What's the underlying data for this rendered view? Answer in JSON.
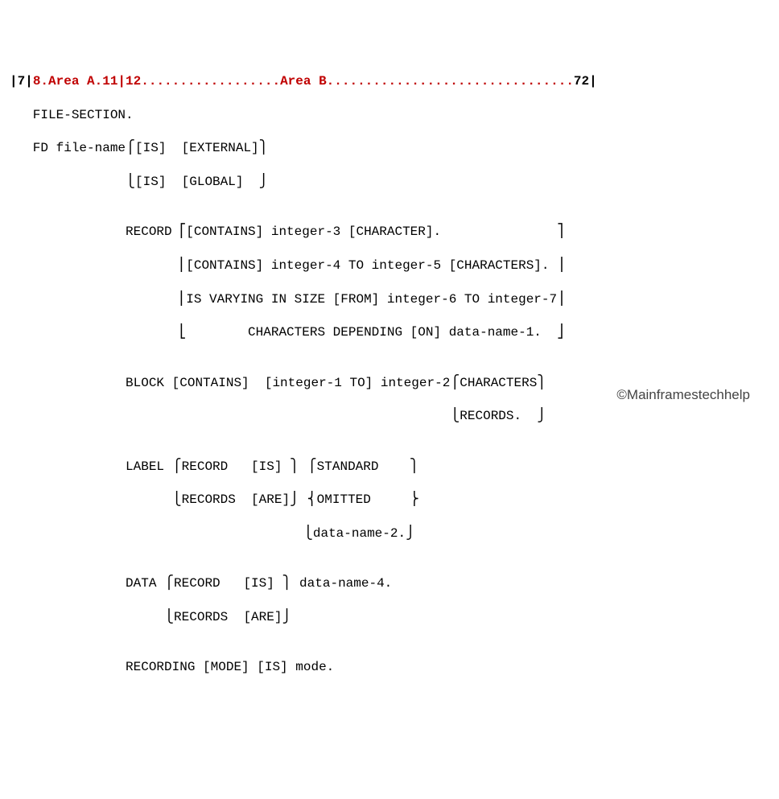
{
  "ruler": {
    "col7": "|7|",
    "col8": "8.",
    "areaA": "Area A",
    "col11": ".11|",
    "col12": "12",
    "dotsL": "..................",
    "areaB": "Area B",
    "dotsR": "................................",
    "col72": "72|"
  },
  "lines": {
    "fileSection": "   FILE-SECTION.",
    "fd1": "   FD file-name⎧[IS]  [EXTERNAL]⎫",
    "fd2": "               ⎩[IS]  [GLOBAL]  ⎭",
    "blank1": "",
    "rec1": "               RECORD ⎡[CONTAINS] integer-3 [CHARACTER].               ⎤",
    "rec2": "                      ⎢[CONTAINS] integer-4 TO integer-5 [CHARACTERS]. ⎥",
    "rec3": "                      ⎢IS VARYING IN SIZE [FROM] integer-6 TO integer-7⎥",
    "rec4": "                      ⎣        CHARACTERS DEPENDING [ON] data-name-1.  ⎦",
    "blank2": "",
    "blk1": "               BLOCK [CONTAINS]  [integer-1 TO] integer-2⎧CHARACTERS⎫",
    "blk2": "                                                         ⎩RECORDS.  ⎭",
    "blank3": "",
    "lab1": "               LABEL ⎧RECORD   [IS] ⎫ ⎧STANDARD    ⎫",
    "lab2": "                     ⎩RECORDS  [ARE]⎭ ⎨OMITTED     ⎬",
    "lab3": "                                      ⎩data-name-2.⎭",
    "blank4": "",
    "dat1": "               DATA ⎧RECORD   [IS] ⎫ data-name-4.",
    "dat2": "                    ⎩RECORDS  [ARE]⎭",
    "blank5": "",
    "recmode": "               RECORDING [MODE] [IS] mode."
  },
  "watermark": "©Mainframestechhelp"
}
